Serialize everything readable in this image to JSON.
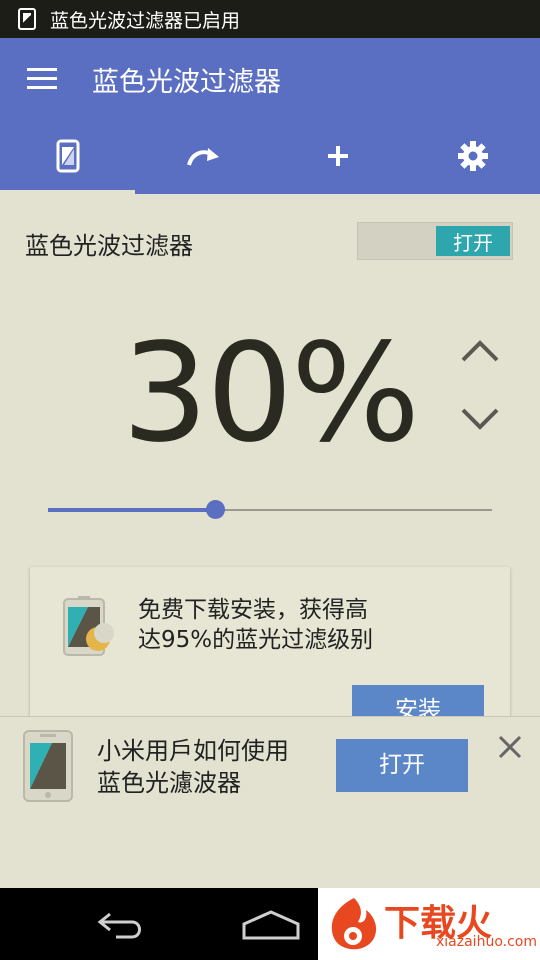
{
  "status_bar": {
    "notification_text": "蓝色光波过滤器已启用",
    "icon": "filter-app-icon"
  },
  "app_bar": {
    "title": "蓝色光波过滤器",
    "menu_icon": "hamburger-menu-icon"
  },
  "tabs": [
    {
      "icon": "phone-filter-icon",
      "active": true
    },
    {
      "icon": "redo-arrow-icon",
      "active": false
    },
    {
      "icon": "plus-icon",
      "active": false
    },
    {
      "icon": "gear-icon",
      "active": false
    }
  ],
  "filter": {
    "label": "蓝色光波过滤器",
    "toggle_label": "打开",
    "percent_text": "30%",
    "opacity_level_percent": 30
  },
  "promo_card": {
    "text_line1": "免费下载安装，获得高",
    "text_line2": "达95%的蓝光过滤级别",
    "install_label": "安装"
  },
  "banner": {
    "text_line1": "小米用戶如何使用",
    "text_line2": "蓝色光濾波器",
    "open_label": "打开"
  },
  "watermark": {
    "main": "下载火",
    "sub": "xiazaihuo.com"
  },
  "colors": {
    "primary": "#5b6fc2",
    "accent": "#2ea6ad",
    "button": "#5b86c8",
    "background": "#e3e2d0"
  }
}
